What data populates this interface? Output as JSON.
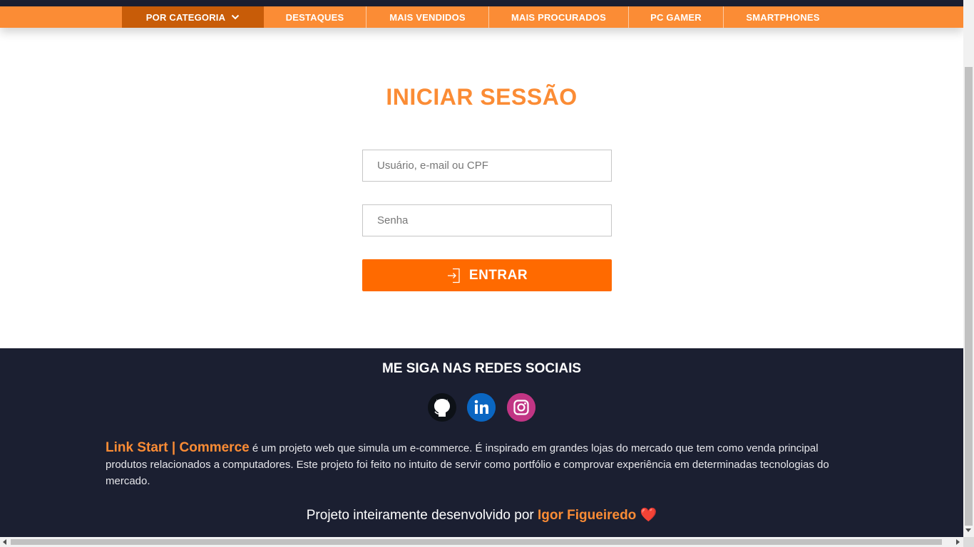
{
  "nav": {
    "items": [
      {
        "label": "POR CATEGORIA"
      },
      {
        "label": "DESTAQUES"
      },
      {
        "label": "MAIS VENDIDOS"
      },
      {
        "label": "MAIS PROCURADOS"
      },
      {
        "label": "PC GAMER"
      },
      {
        "label": "SMARTPHONES"
      }
    ],
    "active_index": 0
  },
  "login": {
    "title": "INICIAR SESSÃO",
    "user_placeholder": "Usuário, e-mail ou CPF",
    "password_placeholder": "Senha",
    "submit_label": "ENTRAR",
    "submit_icon": "login-icon"
  },
  "footer": {
    "social_title": "ME SIGA NAS REDES SOCIAIS",
    "social_icons": [
      "github-icon",
      "linkedin-icon",
      "instagram-icon"
    ],
    "brand": "Link Start | Commerce",
    "description": " é um projeto web que simula um e-commerce. É inspirado em grandes lojas do mercado que tem como venda principal produtos relacionados a computadores. Este projeto foi feito no intuito de servir como portfólio e comprovar experiência em determinadas tecnologias do mercado.",
    "credit_prefix": "Projeto inteiramente desenvolvido por ",
    "author": "Igor Figueiredo",
    "heart": "❤️"
  },
  "colors": {
    "accent": "#fb8c35",
    "accent_dark": "#c85c08",
    "button": "#ff6a00",
    "footer_bg": "#1b1f31",
    "linkedin": "#0a66c2",
    "instagram": "#c13584"
  }
}
